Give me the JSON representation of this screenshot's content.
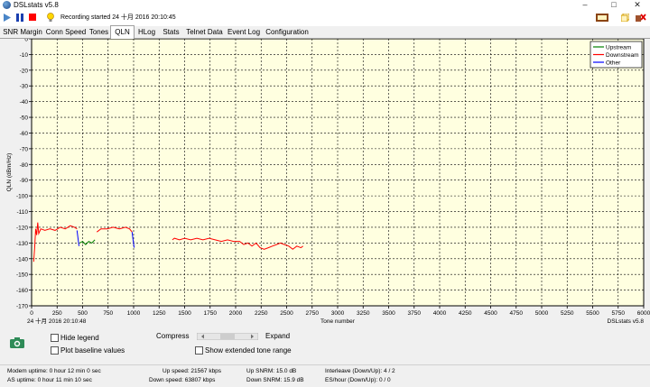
{
  "window": {
    "title": "DSLstats v5.8"
  },
  "toolbar": {
    "recording": "Recording started 24 十月 2016 20:10:45"
  },
  "tabs": [
    {
      "label": "SNR Margin"
    },
    {
      "label": "Conn Speed"
    },
    {
      "label": "Tones"
    },
    {
      "label": "QLN"
    },
    {
      "label": "HLog"
    },
    {
      "label": "Stats"
    },
    {
      "label": "Telnet Data"
    },
    {
      "label": "Event Log"
    },
    {
      "label": "Configuration"
    }
  ],
  "active_tab": "QLN",
  "chart_data": {
    "type": "line",
    "ylabel": "QLN (dBm/Hz)",
    "xlabel": "Tone number",
    "footer_left": "24 十月 2016 20:10:48",
    "footer_right": "DSLstats v5.8",
    "xlim": [
      0,
      6000
    ],
    "ylim": [
      -170,
      0
    ],
    "x_ticks": [
      0,
      250,
      500,
      750,
      1000,
      1250,
      1500,
      1750,
      2000,
      2250,
      2500,
      2750,
      3000,
      3250,
      3500,
      3750,
      4000,
      4250,
      4500,
      4750,
      5000,
      5250,
      5500,
      5750,
      6000
    ],
    "y_ticks": [
      0,
      -10,
      -20,
      -30,
      -40,
      -50,
      -60,
      -70,
      -80,
      -90,
      -100,
      -110,
      -120,
      -130,
      -140,
      -150,
      -160,
      -170
    ],
    "grid": true,
    "legend_position": "top-right",
    "background": "#ffffe0",
    "series": [
      {
        "name": "Upstream",
        "color": "#008000",
        "segments": [
          [
            [
              470,
              -130
            ],
            [
              500,
              -129
            ],
            [
              530,
              -131
            ],
            [
              560,
              -129
            ],
            [
              590,
              -130
            ],
            [
              620,
              -128
            ]
          ]
        ]
      },
      {
        "name": "Downstream",
        "color": "#ff0000",
        "segments": [
          [
            [
              20,
              -142
            ],
            [
              30,
              -133
            ],
            [
              40,
              -121
            ],
            [
              50,
              -125
            ],
            [
              60,
              -117
            ],
            [
              70,
              -124
            ],
            [
              90,
              -121
            ],
            [
              130,
              -122
            ],
            [
              180,
              -121
            ],
            [
              230,
              -122
            ],
            [
              280,
              -120
            ],
            [
              330,
              -121
            ],
            [
              380,
              -119
            ],
            [
              420,
              -120
            ],
            [
              445,
              -121
            ]
          ],
          [
            [
              640,
              -123
            ],
            [
              680,
              -121
            ],
            [
              740,
              -121
            ],
            [
              800,
              -120
            ],
            [
              860,
              -121
            ],
            [
              920,
              -120
            ],
            [
              960,
              -121
            ],
            [
              985,
              -123
            ]
          ],
          [
            [
              1380,
              -128
            ],
            [
              1400,
              -127
            ],
            [
              1450,
              -128
            ],
            [
              1500,
              -127
            ],
            [
              1560,
              -128
            ],
            [
              1620,
              -127
            ],
            [
              1680,
              -128
            ],
            [
              1740,
              -127
            ],
            [
              1800,
              -128
            ],
            [
              1860,
              -129
            ],
            [
              1920,
              -128
            ],
            [
              1980,
              -129
            ],
            [
              2040,
              -129
            ],
            [
              2080,
              -131
            ],
            [
              2120,
              -130
            ],
            [
              2160,
              -132
            ],
            [
              2200,
              -130
            ],
            [
              2240,
              -133
            ],
            [
              2280,
              -134
            ],
            [
              2320,
              -133
            ],
            [
              2360,
              -132
            ],
            [
              2400,
              -131
            ],
            [
              2440,
              -130
            ],
            [
              2480,
              -131
            ],
            [
              2520,
              -132
            ],
            [
              2560,
              -134
            ],
            [
              2600,
              -132
            ],
            [
              2640,
              -133
            ],
            [
              2660,
              -132
            ]
          ]
        ]
      },
      {
        "name": "Other",
        "color": "#0000ff",
        "segments": [
          [
            [
              445,
              -122
            ],
            [
              455,
              -127
            ],
            [
              465,
              -132
            ]
          ],
          [
            [
              985,
              -123
            ],
            [
              995,
              -128
            ],
            [
              1005,
              -133
            ]
          ]
        ]
      }
    ]
  },
  "controls": {
    "hide_legend": "Hide legend",
    "plot_baseline": "Plot baseline values",
    "compress": "Compress",
    "expand": "Expand",
    "show_extended": "Show extended tone range",
    "slider_value": 0.5
  },
  "status": {
    "modem_uptime": "Modem uptime:  0 hour 12 min 0 sec",
    "as_uptime": "AS uptime:  0 hour 11 min 10 sec",
    "up_speed": "Up speed: 21567 kbps",
    "down_speed": "Down speed: 63807 kbps",
    "up_snrm": "Up SNRM: 15.0 dB",
    "down_snrm": "Down SNRM: 15.9 dB",
    "interleave": "Interleave (Down/Up): 4 / 2",
    "es_hour": "ES/hour (Down/Up): 0 / 0"
  },
  "colors": {
    "plot_bg": "#ffffe0",
    "accent_blue": "#0000ff",
    "record_red": "#ff0000"
  },
  "icons": [
    "app-icon",
    "play-icon",
    "pause-icon",
    "stop-icon",
    "help-bulb-icon",
    "dslstats-logo-icon",
    "restore-icon",
    "close-app-icon",
    "camera-icon"
  ]
}
